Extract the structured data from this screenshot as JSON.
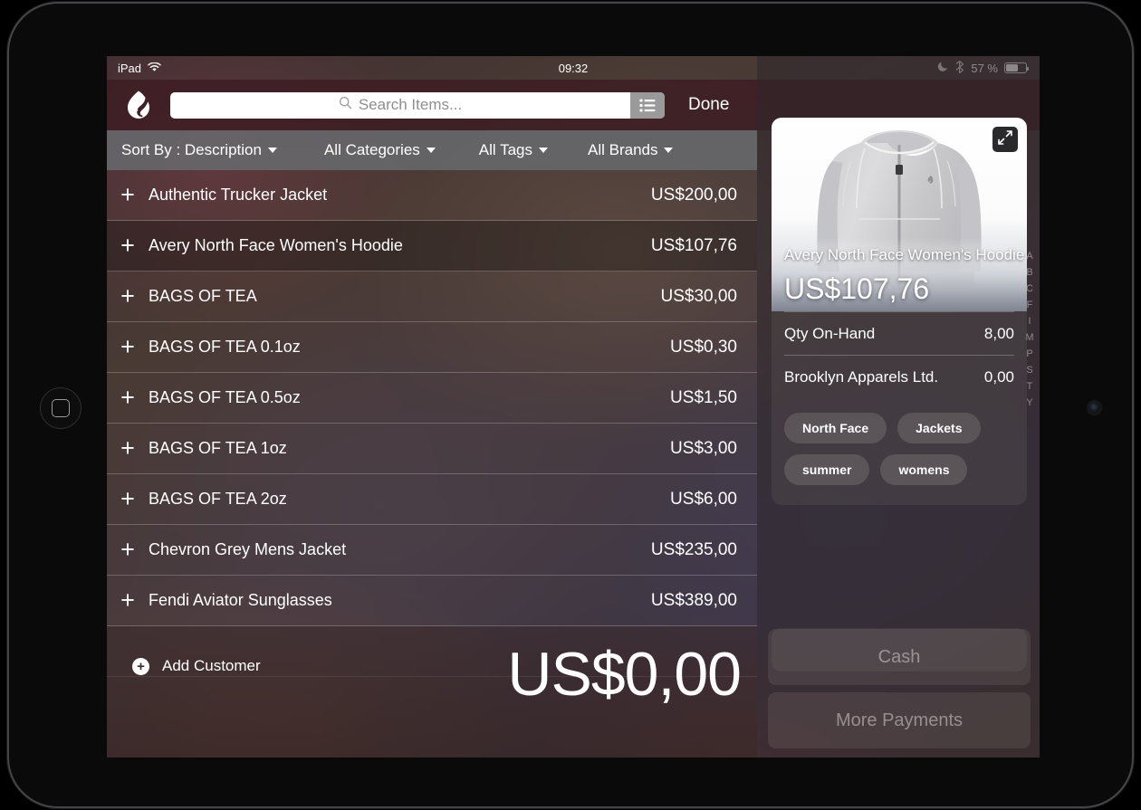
{
  "status_bar": {
    "device": "iPad",
    "wifi_icon": "wifi-icon",
    "time": "09:32",
    "dnd_icon": "moon-icon",
    "bluetooth_icon": "bluetooth-icon",
    "battery_percent": "57 %"
  },
  "nav": {
    "logo_icon": "lightspeed-logo-icon",
    "search_placeholder": "Search Items...",
    "search_value": "",
    "search_icon": "search-icon",
    "list_toggle_icon": "list-view-icon",
    "done_label": "Done"
  },
  "filters": {
    "sort": "Sort By : Description",
    "categories": "All Categories",
    "tags": "All Tags",
    "brands": "All Brands"
  },
  "items": [
    {
      "name": "Authentic Trucker Jacket",
      "price": "US$200,00",
      "selected": false
    },
    {
      "name": "Avery North Face Women's Hoodie",
      "price": "US$107,76",
      "selected": true
    },
    {
      "name": "BAGS OF TEA",
      "price": "US$30,00",
      "selected": false
    },
    {
      "name": "BAGS OF TEA 0.1oz",
      "price": "US$0,30",
      "selected": false
    },
    {
      "name": "BAGS OF TEA 0.5oz",
      "price": "US$1,50",
      "selected": false
    },
    {
      "name": "BAGS OF TEA 1oz",
      "price": "US$3,00",
      "selected": false
    },
    {
      "name": "BAGS OF TEA 2oz",
      "price": "US$6,00",
      "selected": false
    },
    {
      "name": "Chevron Grey Mens Jacket",
      "price": "US$235,00",
      "selected": false
    },
    {
      "name": "Fendi Aviator Sunglasses",
      "price": "US$389,00",
      "selected": false
    }
  ],
  "alpha_index": [
    "A",
    "B",
    "C",
    "F",
    "I",
    "M",
    "P",
    "S",
    "T",
    "Y"
  ],
  "bottom_bar": {
    "add_customer_label": "Add Customer",
    "add_customer_icon": "plus-circle-icon",
    "grand_total": "US$0,00"
  },
  "detail": {
    "expand_icon": "expand-arrows-icon",
    "product_title": "Avery North Face Women's Hoodie",
    "product_price": "US$107,76",
    "rows": [
      {
        "label": "Qty On-Hand",
        "value": "8,00"
      },
      {
        "label": "Brooklyn Apparels Ltd.",
        "value": "0,00"
      }
    ],
    "tags": [
      "North Face",
      "Jackets",
      "summer",
      "womens"
    ],
    "pay_buttons": [
      "Cash",
      "More Payments"
    ]
  },
  "colors": {
    "nav_maroon": "#3c1c22",
    "filter_gray": "#686a6e",
    "accent_white": "#ffffff",
    "search_field": "#ffffff"
  }
}
